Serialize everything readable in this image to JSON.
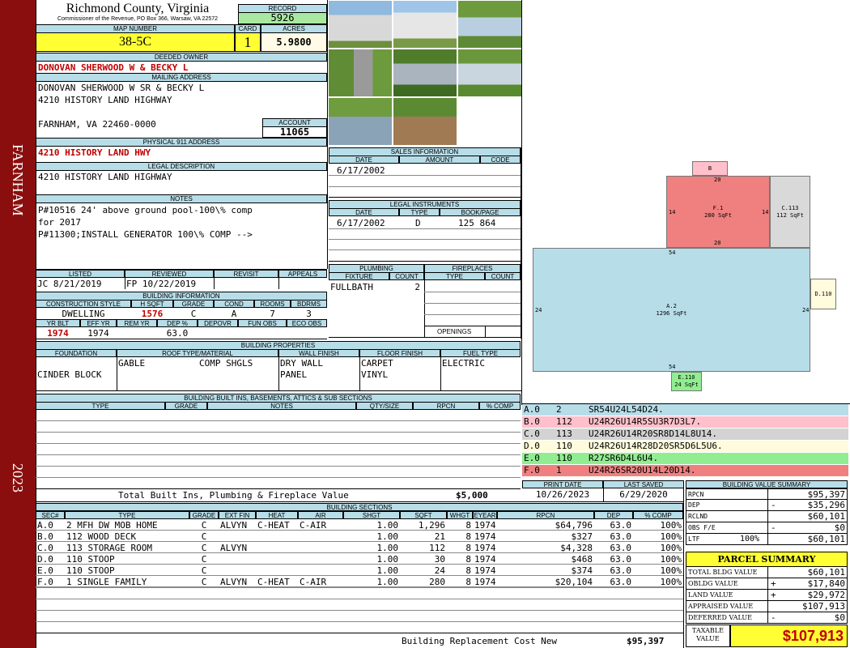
{
  "county": {
    "name": "Richmond County, Virginia",
    "address": "Commissioner of the Revenue, PO Box 366, Warsaw, VA 22572"
  },
  "sidebar": {
    "town": "FARNHAM",
    "year": "2023"
  },
  "record": {
    "label": "RECORD",
    "value": "5926"
  },
  "map": {
    "label": "MAP NUMBER",
    "value": "38-5C"
  },
  "card": {
    "label": "CARD",
    "value": "1"
  },
  "acres": {
    "label": "ACRES",
    "value": "5.9800"
  },
  "deeded_owner": {
    "label": "DEEDED OWNER",
    "value": "DONOVAN SHERWOOD W & BECKY L"
  },
  "mailing": {
    "label": "MAILING ADDRESS",
    "line1": "DONOVAN SHERWOOD W SR & BECKY L",
    "line2": "4210 HISTORY LAND HIGHWAY",
    "line3": "FARNHAM, VA 22460-0000"
  },
  "account": {
    "label": "ACCOUNT",
    "value": "11065"
  },
  "physical": {
    "label": "PHYSICAL 911 ADDRESS",
    "value": "4210 HISTORY LAND HWY"
  },
  "legal": {
    "label": "LEGAL DESCRIPTION",
    "value": "4210 HISTORY LAND HIGHWAY"
  },
  "notes": {
    "label": "NOTES",
    "line1": "P#10516 24' above ground pool-100\\% comp",
    "line2": "for 2017",
    "line3": "P#11300;INSTALL GENERATOR 100\\% COMP -->"
  },
  "sales": {
    "label": "SALES INFORMATION",
    "cols": [
      "DATE",
      "AMOUNT",
      "CODE"
    ],
    "row_date": "6/17/2002"
  },
  "legal_instruments": {
    "label": "LEGAL INSTRUMENTS",
    "cols": [
      "DATE",
      "TYPE",
      "BOOK/PAGE"
    ],
    "row": {
      "date": "6/17/2002",
      "type": "D",
      "book": "125 864"
    }
  },
  "listed": {
    "label": "LISTED",
    "value": "JC    8/21/2019"
  },
  "reviewed": {
    "label": "REVIEWED",
    "value": "FP  10/22/2019"
  },
  "revisit": {
    "label": "REVISIT"
  },
  "appeals": {
    "label": "APPEALS"
  },
  "building_info": {
    "label": "BUILDING INFORMATION",
    "cols": [
      "CONSTRUCTION STYLE",
      "H SQFT",
      "GRADE",
      "COND",
      "ROOMS",
      "BDRMS"
    ],
    "vals": [
      "DWELLING",
      "1576",
      "C",
      "A",
      "7",
      "3"
    ],
    "cols2": [
      "YR BLT",
      "EFF YR",
      "REM YR",
      "DEP %",
      "DEPOVR",
      "FUN OBS",
      "ECO OBS"
    ],
    "vals2": [
      "1974",
      "1974",
      "",
      "63.0",
      "",
      "",
      ""
    ]
  },
  "plumbing": {
    "label": "PLUMBING",
    "cols": [
      "FIXTURE",
      "COUNT"
    ],
    "fixture": "FULLBATH",
    "count": "2"
  },
  "fireplaces": {
    "label": "FIREPLACES",
    "cols": [
      "TYPE",
      "COUNT"
    ],
    "openings": "OPENINGS"
  },
  "properties": {
    "label": "BUILDING PROPERTIES",
    "cols": [
      "FOUNDATION",
      "ROOF TYPE/MATERIAL",
      "WALL FINISH",
      "FLOOR FINISH",
      "FUEL TYPE"
    ],
    "foundation": "CINDER BLOCK",
    "roof1": "GABLE",
    "roof2": "COMP SHGLS",
    "wall1": "DRY WALL",
    "wall2": "PANEL",
    "floor1": "CARPET",
    "floor2": "VINYL",
    "fuel": "ELECTRIC"
  },
  "builtins": {
    "label": "BUILDING BUILT INS, BASEMENTS, ATTICS & SUB SECTIONS",
    "cols": [
      "TYPE",
      "GRADE",
      "NOTES",
      "QTY/SIZE",
      "RPCN",
      "% COMP"
    ],
    "total_label": "Total Built Ins, Plumbing & Fireplace Value",
    "total_value": "$5,000"
  },
  "print": {
    "label": "PRINT DATE",
    "value": "10/26/2023"
  },
  "saved": {
    "label": "LAST SAVED",
    "value": "6/29/2020"
  },
  "sections": {
    "label": "BUILDING SECTIONS",
    "cols": [
      "SEC#",
      "TYPE",
      "GRADE",
      "EXT FIN",
      "HEAT",
      "AIR",
      "SHGT",
      "SQFT",
      "WHGT",
      "EYEAR",
      "RPCN",
      "DEP",
      "% COMP"
    ],
    "rows": [
      [
        "A.0",
        "2 MFH DW MOB HOME",
        "C",
        "ALVYN",
        "C-HEAT",
        "C-AIR",
        "1.00",
        "1,296",
        "8",
        "1974",
        "$64,796",
        "63.0",
        "100%"
      ],
      [
        "B.0",
        "112 WOOD DECK",
        "C",
        "",
        "",
        "",
        "1.00",
        "21",
        "8",
        "1974",
        "$327",
        "63.0",
        "100%"
      ],
      [
        "C.0",
        "113 STORAGE ROOM",
        "C",
        "ALVYN",
        "",
        "",
        "1.00",
        "112",
        "8",
        "1974",
        "$4,328",
        "63.0",
        "100%"
      ],
      [
        "D.0",
        "110 STOOP",
        "C",
        "",
        "",
        "",
        "1.00",
        "30",
        "8",
        "1974",
        "$468",
        "63.0",
        "100%"
      ],
      [
        "E.0",
        "110 STOOP",
        "C",
        "",
        "",
        "",
        "1.00",
        "24",
        "8",
        "1974",
        "$374",
        "63.0",
        "100%"
      ],
      [
        "F.0",
        "1 SINGLE FAMILY",
        "C",
        "ALVYN",
        "C-HEAT",
        "C-AIR",
        "1.00",
        "280",
        "8",
        "1974",
        "$20,104",
        "63.0",
        "100%"
      ]
    ],
    "total_label": "Building Replacement Cost New",
    "total_value": "$95,397"
  },
  "sketch": {
    "areas": [
      {
        "id": "B",
        "label": "B"
      },
      {
        "id": "F",
        "label": "F.1",
        "sqft": "280 SqFt"
      },
      {
        "id": "C",
        "label": "C.113",
        "sqft": "112 SqFt"
      },
      {
        "id": "A",
        "label": "A.2",
        "sqft": "1296 SqFt"
      },
      {
        "id": "D",
        "label": "D.110"
      },
      {
        "id": "E",
        "label": "E.110",
        "sqft": "24 SqFt"
      }
    ],
    "dims": [
      "20",
      "14",
      "14",
      "20",
      "54",
      "24",
      "24",
      "54"
    ]
  },
  "segments": [
    {
      "code": "A.0",
      "num": "2",
      "path": "SR54U24L54D24.",
      "color": "#b7dde8"
    },
    {
      "code": "B.0",
      "num": "112",
      "path": "U24R26U14R5SU3R7D3L7.",
      "color": "#ffc0cb"
    },
    {
      "code": "C.0",
      "num": "113",
      "path": "U24R26U14R20SR8D14L8U14.",
      "color": "#d3d3d3"
    },
    {
      "code": "D.0",
      "num": "110",
      "path": "U24R26U14R28D20SR5D6L5U6.",
      "color": "#fffbdc"
    },
    {
      "code": "E.0",
      "num": "110",
      "path": "R27SR6D4L6U4.",
      "color": "#90ee90"
    },
    {
      "code": "F.0",
      "num": "1",
      "path": "U24R26SR20U14L20D14.",
      "color": "#f08080"
    }
  ],
  "value_summary": {
    "label": "BUILDING VALUE SUMMARY",
    "rows": [
      {
        "k": "RPCN",
        "s": "",
        "v": "$95,397"
      },
      {
        "k": "DEP",
        "s": "-",
        "v": "$35,296"
      },
      {
        "k": "RCLND",
        "s": "",
        "v": "$60,101"
      },
      {
        "k": "OBS F/E",
        "s": "-",
        "v": "$0"
      },
      {
        "k": "LTF",
        "pct": "100%",
        "s": "",
        "v": "$60,101"
      }
    ]
  },
  "parcel": {
    "title": "PARCEL SUMMARY",
    "rows": [
      {
        "k": "TOTAL BLDG VALUE",
        "s": "",
        "v": "$60,101"
      },
      {
        "k": "OBLDG VALUE",
        "s": "+",
        "v": "$17,840"
      },
      {
        "k": "LAND VALUE",
        "s": "+",
        "v": "$29,972"
      },
      {
        "k": "APPRAISED VALUE",
        "s": "",
        "v": "$107,913"
      },
      {
        "k": "DEFERRED VALUE",
        "s": "-",
        "v": "$0"
      }
    ],
    "taxable_label": "TAXABLE VALUE",
    "taxable_value": "$107,913"
  },
  "colors": {
    "sidebar": "#8b0e0e",
    "label_bg": "#b7dde8",
    "yellow": "#ffff33",
    "red_text": "#c00000"
  }
}
